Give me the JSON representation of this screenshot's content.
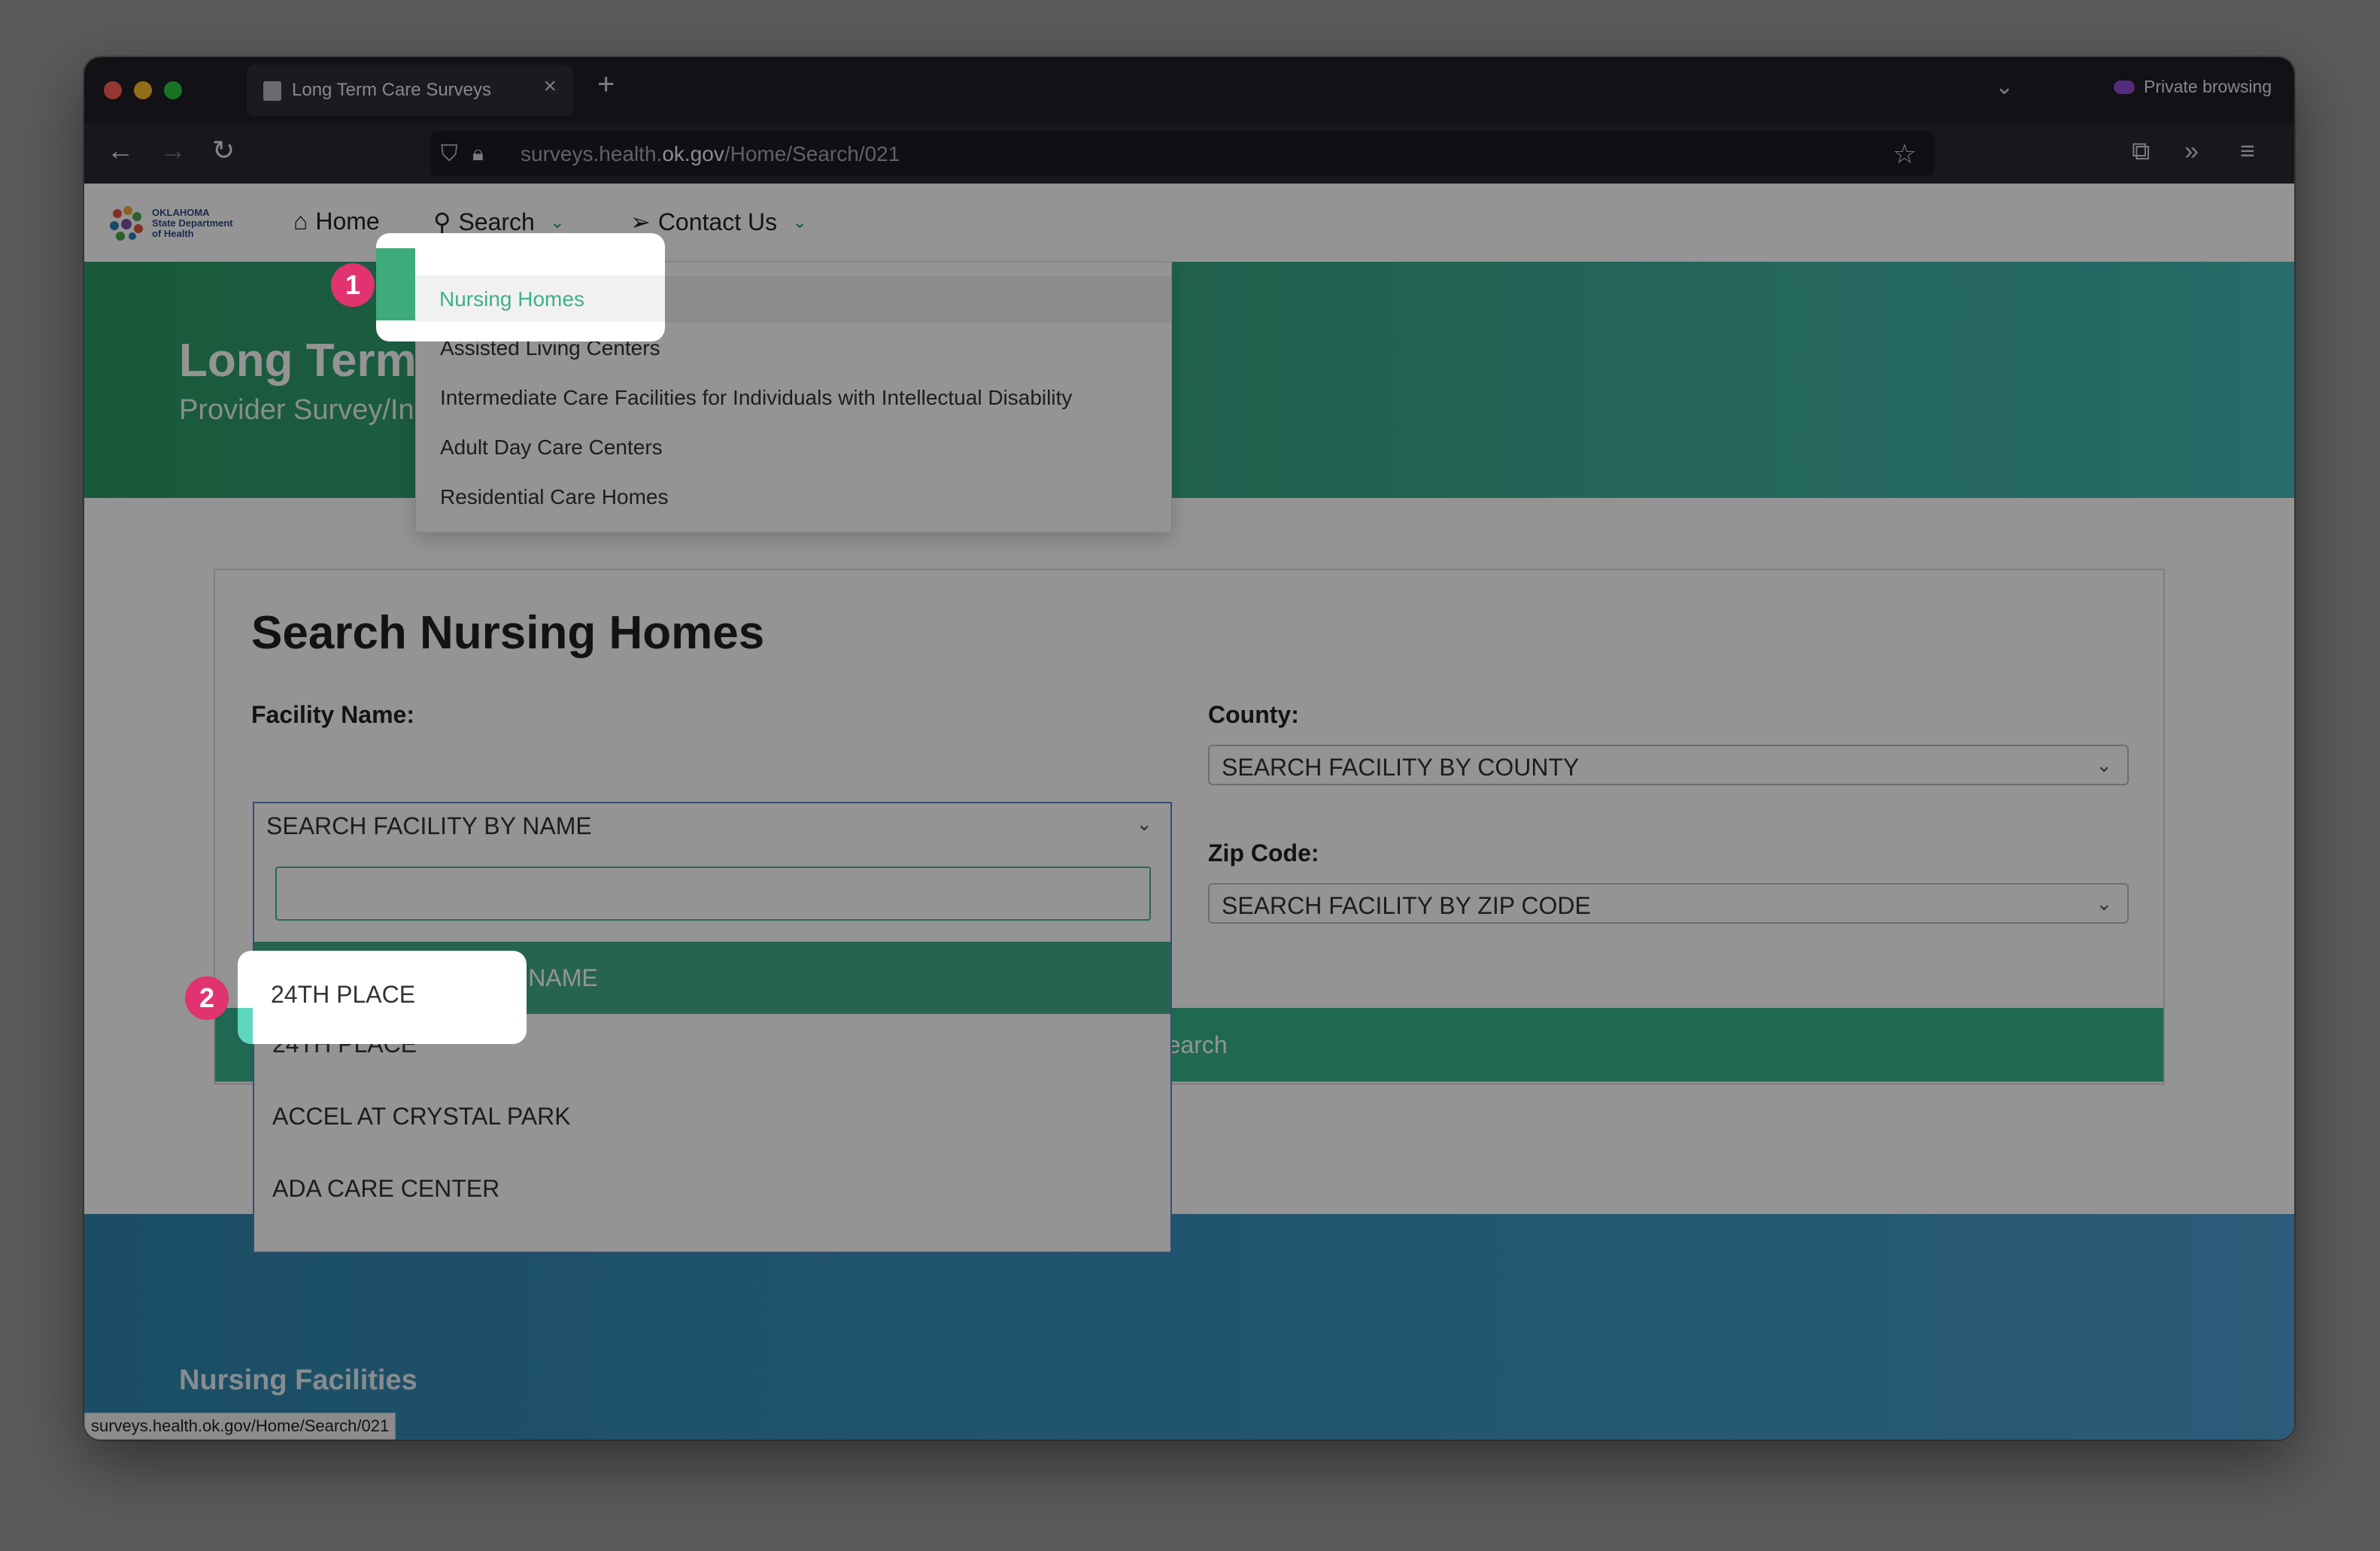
{
  "browser": {
    "tab_title": "Long Term Care Surveys",
    "new_tab": "+",
    "private_label": "Private browsing",
    "url_prefix": "surveys.health.",
    "url_domain": "ok.gov",
    "url_path": "/Home/Search/021",
    "status_url": "surveys.health.ok.gov/Home/Search/021"
  },
  "site": {
    "logo_text": [
      "OKLAHOMA",
      "State Department",
      "of Health"
    ],
    "nav": {
      "home": "Home",
      "search": "Search",
      "contact": "Contact Us"
    },
    "search_menu": [
      "Nursing Homes",
      "Assisted Living Centers",
      "Intermediate Care Facilities for Individuals with Intellectual Disability",
      "Adult Day Care Centers",
      "Residential Care Homes"
    ],
    "hero": {
      "title": "Long Term",
      "subtitle": "Provider Survey/In"
    }
  },
  "search_form": {
    "title": "Search Nursing Homes",
    "facility_label": "Facility Name:",
    "facility_value": "SEARCH FACILITY BY NAME",
    "facility_filter_value": "",
    "facility_options": [
      "SEARCH FACILITY BY NAME",
      "24TH PLACE",
      "ACCEL AT CRYSTAL PARK",
      "ADA CARE CENTER"
    ],
    "county_label": "County:",
    "county_value": "SEARCH FACILITY BY COUNTY",
    "zip_label": "Zip Code:",
    "zip_value": "SEARCH FACILITY BY ZIP CODE",
    "search_button": "Search"
  },
  "footer": {
    "title": "Nursing Facilities"
  },
  "annotations": {
    "step1": "1",
    "step2": "2",
    "accent": "#e0336f"
  }
}
